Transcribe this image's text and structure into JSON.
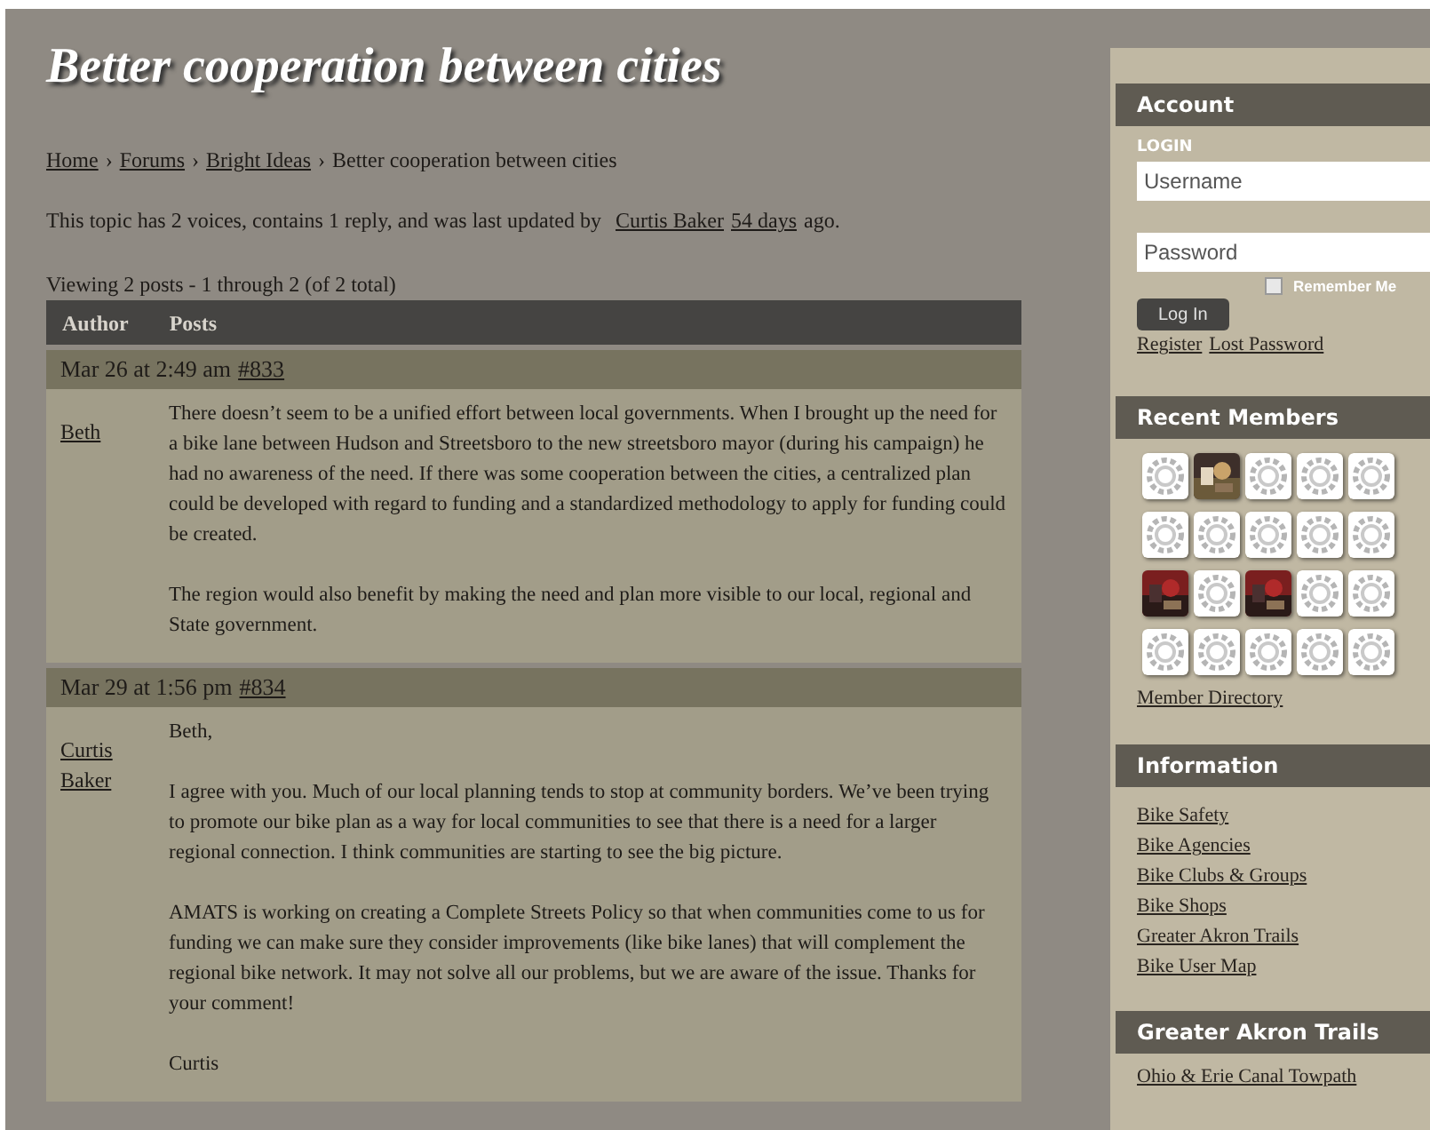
{
  "title": "Better cooperation between cities",
  "breadcrumb": [
    {
      "label": "Home",
      "kind": "link"
    },
    {
      "label": "›",
      "kind": "separator"
    },
    {
      "label": "Forums",
      "kind": "link"
    },
    {
      "label": "›",
      "kind": "separator"
    },
    {
      "label": "Bright Ideas",
      "kind": "link"
    },
    {
      "label": "›",
      "kind": "separator"
    },
    {
      "label": "Better cooperation between cities",
      "kind": "current"
    }
  ],
  "topic_info": {
    "before": "This topic has 2 voices, contains 1 reply, and was last updated by",
    "author": "Curtis Baker",
    "when": "54 days",
    "after": "ago."
  },
  "viewing": "Viewing 2 posts - 1 through 2 (of 2 total)",
  "table": {
    "columns": [
      "Author",
      "Posts"
    ],
    "posts": [
      {
        "date": "Mar 26 at 2:49 am",
        "permalink": "#833",
        "author": "Beth",
        "paragraphs": [
          "There doesn’t seem to be a unified effort between local governments. When I brought up the need for a bike lane between Hudson and Streetsboro to the new streetsboro mayor (during his campaign) he had no awareness of the need. If there was some cooperation between the cities, a centralized plan could be developed with regard to funding and a standardized methodology to apply for funding could be created.",
          "The region would also benefit by making the need and plan more visible to our local, regional and State government."
        ]
      },
      {
        "date": "Mar 29 at 1:56 pm",
        "permalink": "#834",
        "author": "Curtis Baker",
        "paragraphs": [
          "Beth,",
          "I agree with you. Much of our local planning tends to stop at community borders. We’ve been trying to promote our bike plan as a way for local communities to see that there is a need for a larger regional connection. I think communities are starting to see the big picture.",
          "AMATS is working on creating a Complete Streets Policy so that when communities come to us for funding we can make sure they consider improvements (like bike lanes) that will complement the regional bike network. It may not solve all our problems, but we are aware of the issue. Thanks for your comment!",
          "Curtis"
        ]
      }
    ]
  },
  "sidebar": {
    "account": {
      "heading": "Account",
      "login_label": "LOGIN",
      "username": {
        "placeholder": "Username"
      },
      "password": {
        "placeholder": "Password"
      },
      "remember_me": {
        "label": "Remember Me",
        "checked": false
      },
      "login_button": "Log In",
      "links": [
        "Register",
        "Lost Password"
      ]
    },
    "recent_members": {
      "heading": "Recent Members",
      "avatars": [
        {
          "kind": "default"
        },
        {
          "kind": "picture"
        },
        {
          "kind": "default"
        },
        {
          "kind": "default"
        },
        {
          "kind": "default"
        },
        {
          "kind": "default"
        },
        {
          "kind": "default"
        },
        {
          "kind": "default"
        },
        {
          "kind": "default"
        },
        {
          "kind": "default"
        },
        {
          "kind": "picture"
        },
        {
          "kind": "default"
        },
        {
          "kind": "picture"
        },
        {
          "kind": "default"
        },
        {
          "kind": "default"
        },
        {
          "kind": "default"
        },
        {
          "kind": "default"
        },
        {
          "kind": "default"
        },
        {
          "kind": "default"
        },
        {
          "kind": "default"
        }
      ],
      "directory_link": "Member Directory"
    },
    "information": {
      "heading": "Information",
      "links": [
        "Bike Safety",
        "Bike Agencies",
        "Bike Clubs & Groups",
        "Bike Shops",
        "Greater Akron Trails",
        "Bike User Map"
      ]
    },
    "trails": {
      "heading": "Greater Akron Trails",
      "links": [
        "Ohio & Erie Canal Towpath"
      ]
    }
  }
}
